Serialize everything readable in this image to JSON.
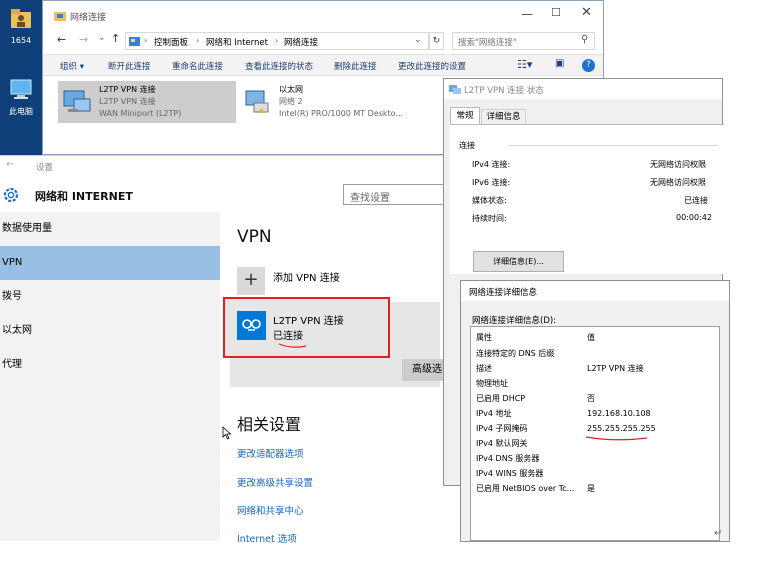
{
  "desktop": {
    "icons": [
      {
        "label": "1654",
        "icon": "folder-user-icon"
      },
      {
        "label": "此电脑",
        "icon": "computer-icon"
      }
    ]
  },
  "explorer": {
    "title": "网络连接",
    "address": {
      "crumbs": [
        "控制面板",
        "网络和 Internet",
        "网络连接"
      ],
      "search_placeholder": "搜索\"网络连接\""
    },
    "commands": [
      "组织 ▾",
      "断开此连接",
      "重命名此连接",
      "查看此连接的状态",
      "删除此连接",
      "更改此连接的设置"
    ],
    "connections": [
      {
        "name": "L2TP VPN 连接",
        "line2": "L2TP VPN 连接",
        "line3": "WAN Miniport (L2TP)"
      },
      {
        "name": "以太网",
        "line2": "网络 2",
        "line3": "Intel(R) PRO/1000 MT Deskto..."
      }
    ]
  },
  "settings": {
    "title": "设置",
    "header": "网络和 INTERNET",
    "search_placeholder": "查找设置",
    "nav": [
      "数据使用量",
      "VPN",
      "拨号",
      "以太网",
      "代理"
    ],
    "selected_nav": "VPN",
    "section_title": "VPN",
    "add_vpn": "添加 VPN 连接",
    "vpn_item": {
      "name": "L2TP VPN 连接",
      "status": "已连接"
    },
    "advanced_button": "高级选",
    "related_title": "相关设置",
    "links": [
      "更改适配器选项",
      "更改高级共享设置",
      "网络和共享中心",
      "Internet 选项"
    ]
  },
  "status_dialog": {
    "title": "L2TP VPN 连接 状态",
    "tabs": [
      "常规",
      "详细信息"
    ],
    "group_label": "连接",
    "rows": [
      {
        "k": "IPv4 连接:",
        "v": "无网络访问权限"
      },
      {
        "k": "IPv6 连接:",
        "v": "无网络访问权限"
      },
      {
        "k": "媒体状态:",
        "v": "已连接"
      },
      {
        "k": "持续时间:",
        "v": "00:00:42"
      }
    ],
    "details_button": "详细信息(E)..."
  },
  "details_dialog": {
    "title": "网络连接详细信息",
    "label": "网络连接详细信息(D):",
    "columns": [
      "属性",
      "值"
    ],
    "rows": [
      {
        "k": "连接特定的 DNS 后缀",
        "v": ""
      },
      {
        "k": "描述",
        "v": "L2TP VPN 连接"
      },
      {
        "k": "物理地址",
        "v": ""
      },
      {
        "k": "已启用 DHCP",
        "v": "否"
      },
      {
        "k": "IPv4 地址",
        "v": "192.168.10.108"
      },
      {
        "k": "IPv4 子网掩码",
        "v": "255.255.255.255"
      },
      {
        "k": "IPv4 默认网关",
        "v": ""
      },
      {
        "k": "IPv4 DNS 服务器",
        "v": ""
      },
      {
        "k": "IPv4 WINS 服务器",
        "v": ""
      },
      {
        "k": "已启用 NetBIOS over Tc...",
        "v": "是"
      }
    ]
  },
  "colors": {
    "accent": "#0078d7",
    "highlight": "#98c0e4",
    "annotation": "#e02020",
    "link": "#1564c0"
  }
}
